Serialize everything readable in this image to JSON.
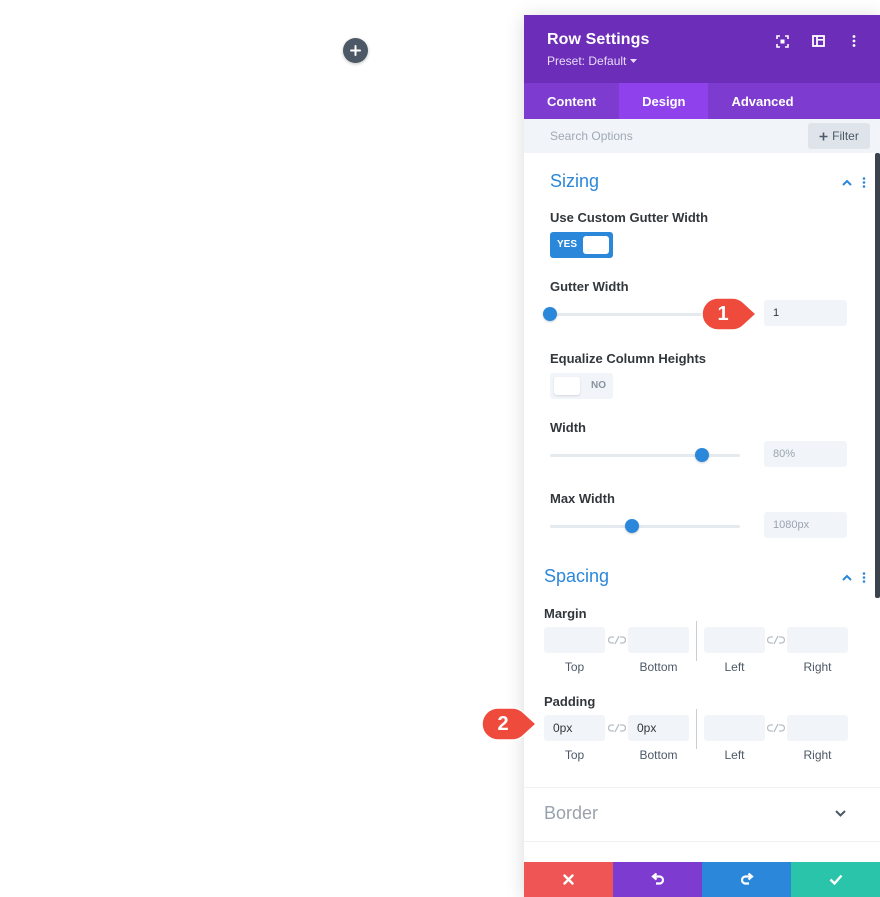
{
  "header": {
    "title": "Row Settings",
    "preset": "Preset: Default"
  },
  "tabs": [
    {
      "label": "Content"
    },
    {
      "label": "Design"
    },
    {
      "label": "Advanced"
    }
  ],
  "search": {
    "placeholder": "Search Options",
    "filter_label": "Filter"
  },
  "sizing": {
    "title": "Sizing",
    "custom_gutter": {
      "label": "Use Custom Gutter Width",
      "toggle_text": "YES",
      "on": true
    },
    "gutter_width": {
      "label": "Gutter Width",
      "value": "1",
      "fraction": 0.0
    },
    "equalize": {
      "label": "Equalize Column Heights",
      "toggle_text": "NO",
      "on": false
    },
    "width": {
      "label": "Width",
      "value": "80%",
      "fraction": 0.8
    },
    "max_width": {
      "label": "Max Width",
      "value": "1080px",
      "fraction": 0.43
    }
  },
  "spacing": {
    "title": "Spacing",
    "margin": {
      "label": "Margin",
      "fields": [
        {
          "label": "Top",
          "value": ""
        },
        {
          "label": "Bottom",
          "value": ""
        },
        {
          "label": "Left",
          "value": ""
        },
        {
          "label": "Right",
          "value": ""
        }
      ]
    },
    "padding": {
      "label": "Padding",
      "fields": [
        {
          "label": "Top",
          "value": "0px"
        },
        {
          "label": "Bottom",
          "value": "0px"
        },
        {
          "label": "Left",
          "value": ""
        },
        {
          "label": "Right",
          "value": ""
        }
      ]
    }
  },
  "border": {
    "title": "Border"
  },
  "callouts": [
    {
      "number": "1"
    },
    {
      "number": "2"
    }
  ],
  "colors": {
    "header_purple": "#6c2eb9",
    "tab_purple": "#7e3bd0",
    "tab_active": "#8f42ec",
    "accent_blue": "#2b87da",
    "cancel_red": "#ef5555",
    "save_teal": "#29c4a9",
    "callout_red": "#ef4b3c"
  },
  "icons": {
    "add": "plus-icon",
    "fullscreen": "fullscreen-icon",
    "layout": "split-layout-icon",
    "more": "more-vertical-icon",
    "link": "link-icon",
    "cancel": "close-icon",
    "undo": "undo-icon",
    "redo": "redo-icon",
    "save": "check-icon"
  }
}
